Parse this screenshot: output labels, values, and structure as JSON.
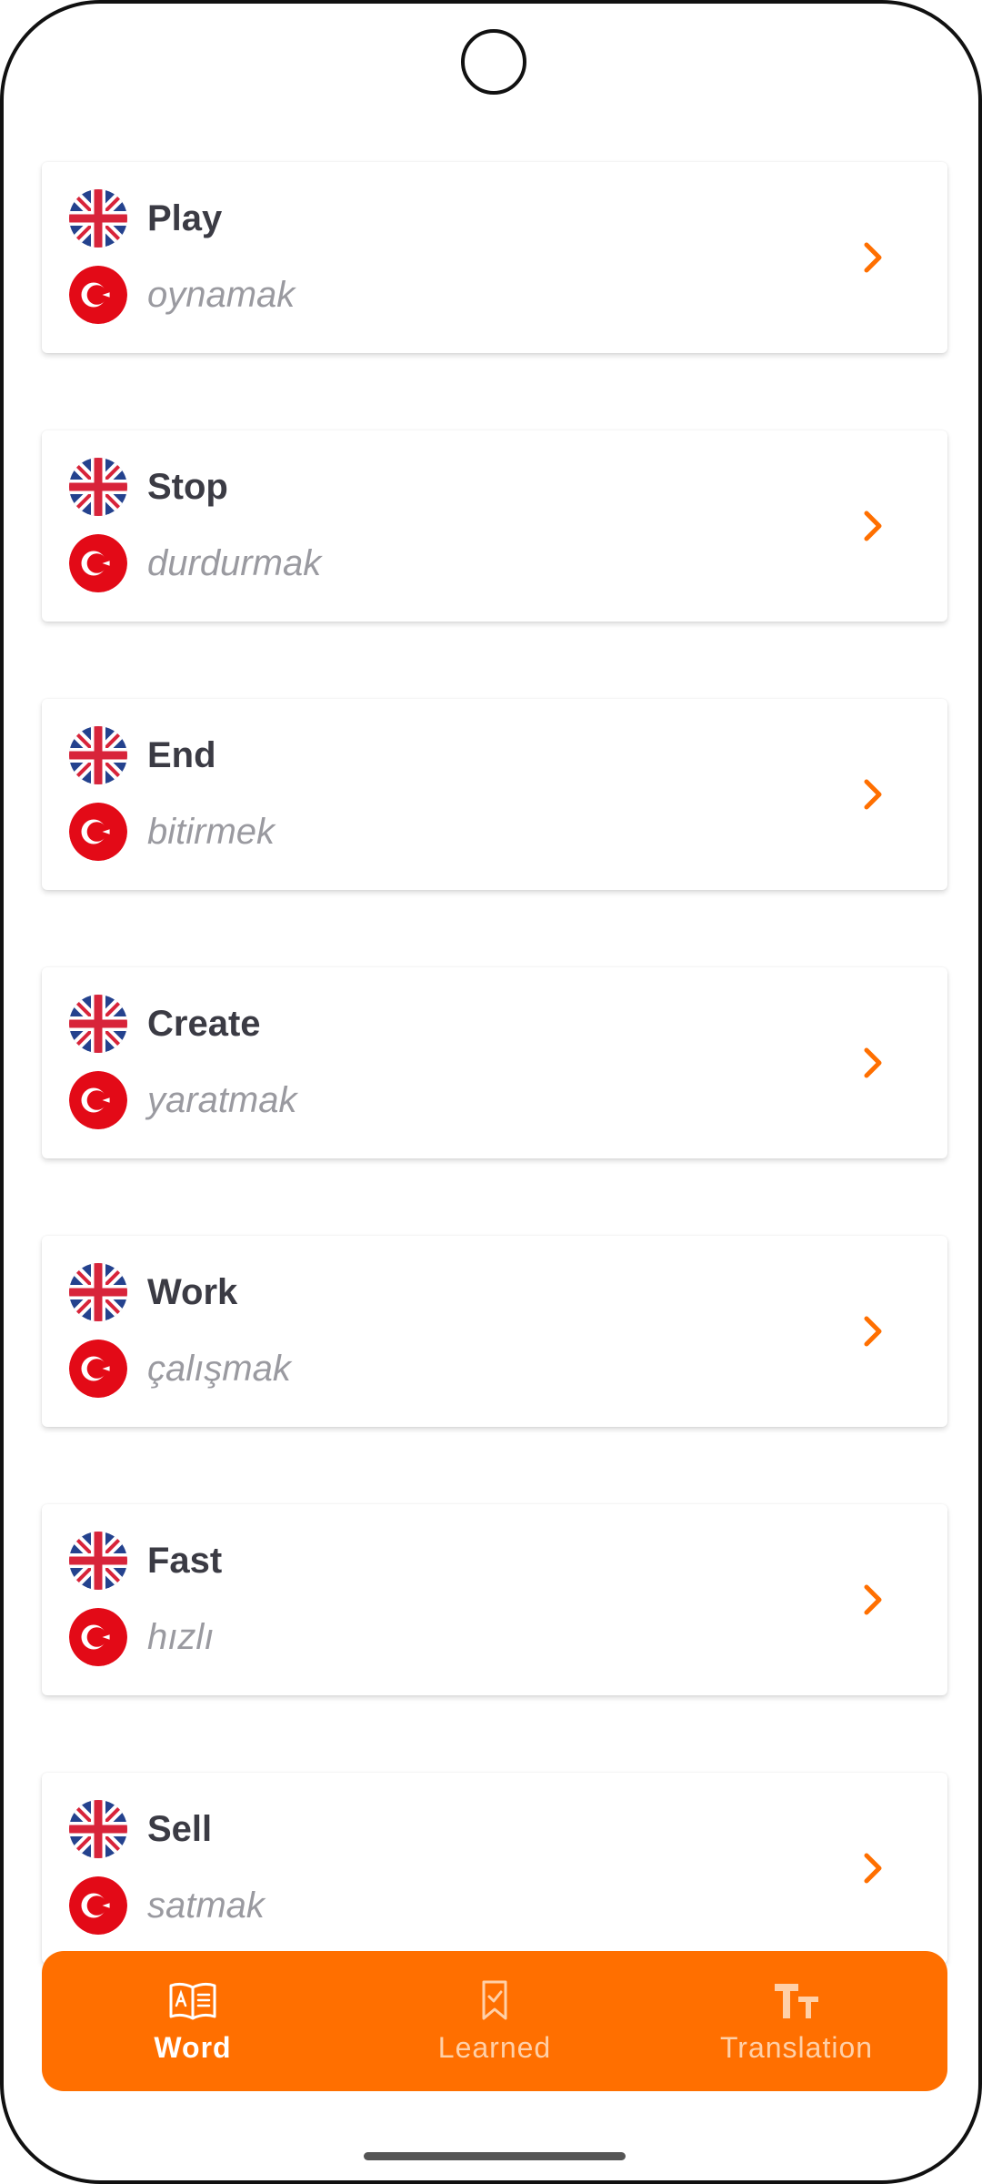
{
  "colors": {
    "accent": "#ff6f00",
    "title_text": "#3b3b44",
    "translation_text": "#9a9aa0"
  },
  "words": [
    {
      "en": "Play",
      "tr": "oynamak"
    },
    {
      "en": "Stop",
      "tr": "durdurmak"
    },
    {
      "en": "End",
      "tr": "bitirmek"
    },
    {
      "en": "Create",
      "tr": "yaratmak"
    },
    {
      "en": "Work",
      "tr": "çalışmak"
    },
    {
      "en": "Fast",
      "tr": "hızlı"
    },
    {
      "en": "Sell",
      "tr": "satmak"
    }
  ],
  "tabs": [
    {
      "label": "Word",
      "icon": "book-icon",
      "active": true
    },
    {
      "label": "Learned",
      "icon": "bookmark-check-icon",
      "active": false
    },
    {
      "label": "Translation",
      "icon": "text-size-icon",
      "active": false
    }
  ]
}
